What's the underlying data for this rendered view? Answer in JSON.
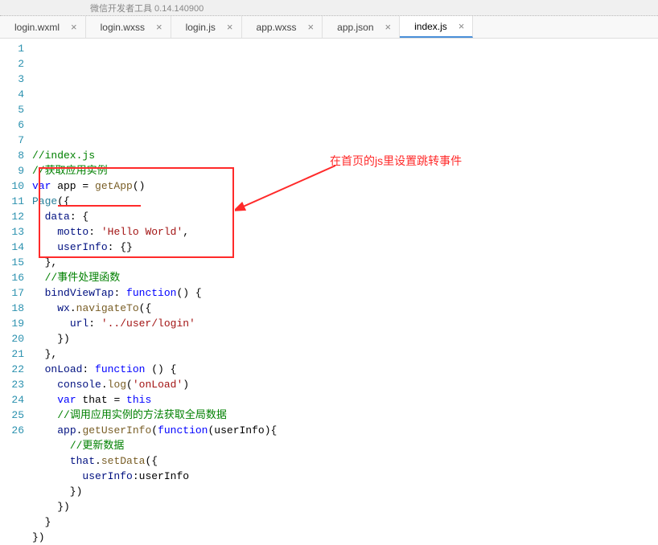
{
  "titlebar": "微信开发者工具 0.14.140900",
  "tabs": [
    {
      "label": "login.wxml",
      "active": false
    },
    {
      "label": "login.wxss",
      "active": false
    },
    {
      "label": "login.js",
      "active": false
    },
    {
      "label": "app.wxss",
      "active": false
    },
    {
      "label": "app.json",
      "active": false
    },
    {
      "label": "index.js",
      "active": true
    }
  ],
  "annotation": {
    "text": "在首页的js里设置跳转事件"
  },
  "code": {
    "lines": [
      [
        {
          "t": "comment",
          "s": "//index.js"
        }
      ],
      [
        {
          "t": "comment",
          "s": "//获取应用实例"
        }
      ],
      [
        {
          "t": "key",
          "s": "var"
        },
        {
          "t": "plain",
          "s": " app "
        },
        {
          "t": "plain",
          "s": "= "
        },
        {
          "t": "func",
          "s": "getApp"
        },
        {
          "t": "plain",
          "s": "()"
        }
      ],
      [
        {
          "t": "type",
          "s": "Page"
        },
        {
          "t": "plain",
          "s": "({"
        }
      ],
      [
        {
          "t": "plain",
          "s": "  "
        },
        {
          "t": "prop",
          "s": "data"
        },
        {
          "t": "plain",
          "s": ": {"
        }
      ],
      [
        {
          "t": "plain",
          "s": "    "
        },
        {
          "t": "prop",
          "s": "motto"
        },
        {
          "t": "plain",
          "s": ": "
        },
        {
          "t": "str",
          "s": "'Hello World'"
        },
        {
          "t": "plain",
          "s": ","
        }
      ],
      [
        {
          "t": "plain",
          "s": "    "
        },
        {
          "t": "prop",
          "s": "userInfo"
        },
        {
          "t": "plain",
          "s": ": {}"
        }
      ],
      [
        {
          "t": "plain",
          "s": "  },"
        }
      ],
      [
        {
          "t": "plain",
          "s": "  "
        },
        {
          "t": "comment",
          "s": "//事件处理函数"
        }
      ],
      [
        {
          "t": "plain",
          "s": "  "
        },
        {
          "t": "prop",
          "s": "bindViewTap"
        },
        {
          "t": "plain",
          "s": ": "
        },
        {
          "t": "key",
          "s": "function"
        },
        {
          "t": "plain",
          "s": "() {"
        }
      ],
      [
        {
          "t": "plain",
          "s": "    "
        },
        {
          "t": "prop",
          "s": "wx"
        },
        {
          "t": "plain",
          "s": "."
        },
        {
          "t": "func",
          "s": "navigateTo"
        },
        {
          "t": "plain",
          "s": "({"
        }
      ],
      [
        {
          "t": "plain",
          "s": "      "
        },
        {
          "t": "prop",
          "s": "url"
        },
        {
          "t": "plain",
          "s": ": "
        },
        {
          "t": "str",
          "s": "'../user/login'"
        }
      ],
      [
        {
          "t": "plain",
          "s": "    })"
        }
      ],
      [
        {
          "t": "plain",
          "s": "  },"
        }
      ],
      [
        {
          "t": "plain",
          "s": "  "
        },
        {
          "t": "prop",
          "s": "onLoad"
        },
        {
          "t": "plain",
          "s": ": "
        },
        {
          "t": "key",
          "s": "function"
        },
        {
          "t": "plain",
          "s": " () {"
        }
      ],
      [
        {
          "t": "plain",
          "s": "    "
        },
        {
          "t": "prop",
          "s": "console"
        },
        {
          "t": "plain",
          "s": "."
        },
        {
          "t": "func",
          "s": "log"
        },
        {
          "t": "plain",
          "s": "("
        },
        {
          "t": "str",
          "s": "'onLoad'"
        },
        {
          "t": "plain",
          "s": ")"
        }
      ],
      [
        {
          "t": "plain",
          "s": "    "
        },
        {
          "t": "key",
          "s": "var"
        },
        {
          "t": "plain",
          "s": " that "
        },
        {
          "t": "plain",
          "s": "= "
        },
        {
          "t": "key",
          "s": "this"
        }
      ],
      [
        {
          "t": "plain",
          "s": "    "
        },
        {
          "t": "comment",
          "s": "//调用应用实例的方法获取全局数据"
        }
      ],
      [
        {
          "t": "plain",
          "s": "    "
        },
        {
          "t": "prop",
          "s": "app"
        },
        {
          "t": "plain",
          "s": "."
        },
        {
          "t": "func",
          "s": "getUserInfo"
        },
        {
          "t": "plain",
          "s": "("
        },
        {
          "t": "key",
          "s": "function"
        },
        {
          "t": "plain",
          "s": "(userInfo){"
        }
      ],
      [
        {
          "t": "plain",
          "s": "      "
        },
        {
          "t": "comment",
          "s": "//更新数据"
        }
      ],
      [
        {
          "t": "plain",
          "s": "      "
        },
        {
          "t": "prop",
          "s": "that"
        },
        {
          "t": "plain",
          "s": "."
        },
        {
          "t": "func",
          "s": "setData"
        },
        {
          "t": "plain",
          "s": "({"
        }
      ],
      [
        {
          "t": "plain",
          "s": "        "
        },
        {
          "t": "prop",
          "s": "userInfo"
        },
        {
          "t": "plain",
          "s": ":userInfo"
        }
      ],
      [
        {
          "t": "plain",
          "s": "      })"
        }
      ],
      [
        {
          "t": "plain",
          "s": "    })"
        }
      ],
      [
        {
          "t": "plain",
          "s": "  }"
        }
      ],
      [
        {
          "t": "plain",
          "s": "})"
        }
      ]
    ]
  }
}
